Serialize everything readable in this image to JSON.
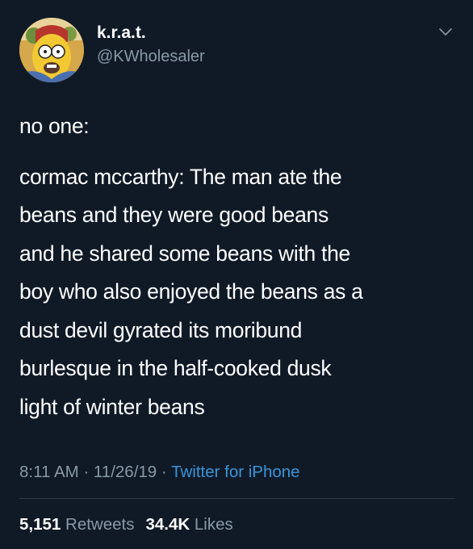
{
  "user": {
    "display_name": "k.r.a.t.",
    "handle": "@KWholesaler"
  },
  "tweet": {
    "lines": [
      "no one:",
      "cormac mccarthy: The man ate the",
      "beans and they were good beans",
      "and he shared some beans with the",
      "boy who also enjoyed the beans as a",
      "dust devil gyrated its moribund",
      "burlesque in the half-cooked dusk",
      "light of winter beans"
    ]
  },
  "meta": {
    "time": "8:11 AM",
    "separator": " · ",
    "date": "11/26/19",
    "source": "Twitter for iPhone"
  },
  "stats": {
    "retweets_count": "5,151",
    "retweets_label": "Retweets",
    "likes_count": "34.4K",
    "likes_label": "Likes"
  },
  "icons": {
    "menu": "chevron-down-icon",
    "avatar": "avatar"
  }
}
